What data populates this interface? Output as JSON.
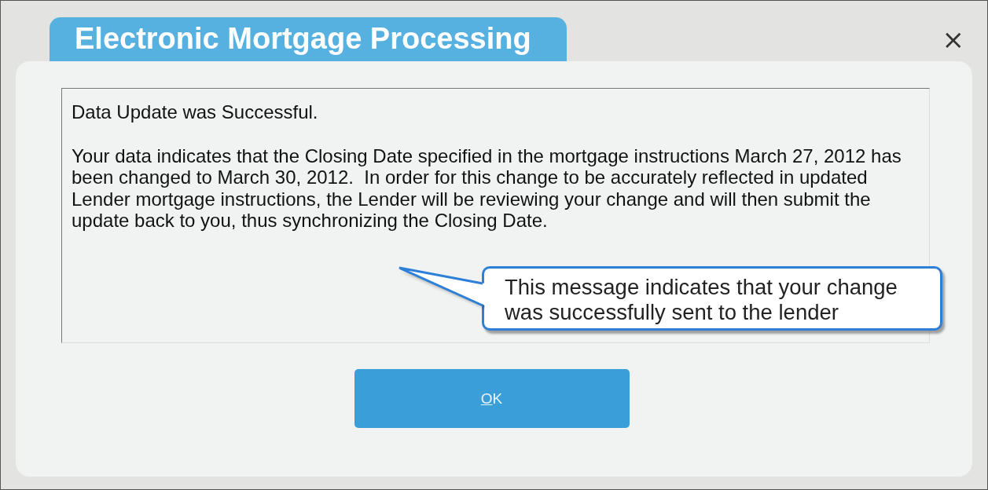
{
  "window": {
    "title": "Electronic Mortgage Processing",
    "close": "×"
  },
  "message": {
    "paragraphs": [
      "Data Update was Successful.",
      "Your data indicates that the Closing Date specified in the mortgage instructions March 27, 2012 has been changed to March 30, 2012.  In order for this change to be accurately reflected in updated Lender mortgage instructions, the Lender will be reviewing your change and will then submit the update back to you, thus synchronizing the Closing Date."
    ]
  },
  "callout": {
    "text": "This message indicates that your change was successfully sent to the lender"
  },
  "buttons": [
    {
      "label": "OK",
      "mnemonic_underlined": true
    }
  ]
}
